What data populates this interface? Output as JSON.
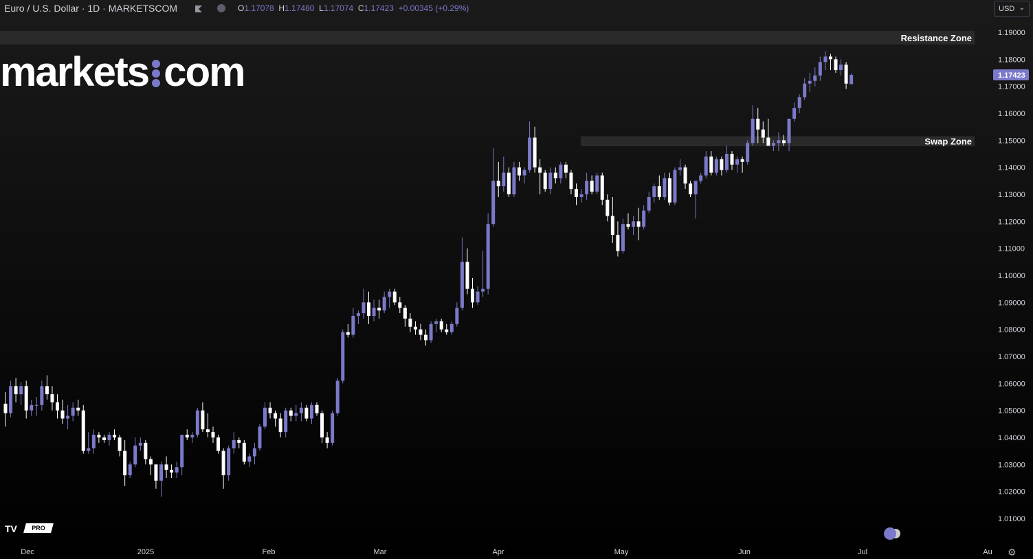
{
  "header": {
    "title": "Euro / U.S. Dollar · 1D · MARKETSCOM",
    "ohlc": {
      "o_label": "O",
      "o_value": "1.17078",
      "h_label": "H",
      "h_value": "1.17480",
      "l_label": "L",
      "l_value": "1.17074",
      "c_label": "C",
      "c_value": "1.17423",
      "change": "+0.00345 (+0.29%)"
    },
    "currency": "USD"
  },
  "logo": {
    "left": "markets",
    "right": "com"
  },
  "badge": {
    "brand": "TV",
    "pro": "PRO"
  },
  "colors": {
    "up": "#7b79c9",
    "down": "#ffffff",
    "zone": "#2a2a2a",
    "last_price_bg": "#7b79c9"
  },
  "chart_data": {
    "type": "candlestick",
    "symbol": "EURUSD",
    "interval": "1D",
    "last_price": "1.17423",
    "ylim": [
      1.005,
      1.1915
    ],
    "y_ticks": [
      "1.19000",
      "1.18000",
      "1.17000",
      "1.16000",
      "1.15000",
      "1.14000",
      "1.13000",
      "1.12000",
      "1.11000",
      "1.10000",
      "1.09000",
      "1.08000",
      "1.07000",
      "1.06000",
      "1.05000",
      "1.04000",
      "1.03000",
      "1.02000",
      "1.01000"
    ],
    "x_labels": [
      "Dec",
      "2025",
      "Feb",
      "Mar",
      "Apr",
      "May",
      "Jun",
      "Jul",
      "Au"
    ],
    "zones": [
      {
        "label": "Resistance Zone",
        "low": 1.1855,
        "high": 1.1905
      },
      {
        "label": "Swap Zone",
        "low": 1.1478,
        "high": 1.1515
      }
    ],
    "candles": [
      [
        1.0525,
        1.0568,
        1.044,
        1.049
      ],
      [
        1.049,
        1.061,
        1.0475,
        1.059
      ],
      [
        1.059,
        1.062,
        1.053,
        1.056
      ],
      [
        1.056,
        1.0605,
        1.052,
        1.059
      ],
      [
        1.059,
        1.061,
        1.047,
        1.05
      ],
      [
        1.05,
        1.054,
        1.048,
        1.052
      ],
      [
        1.052,
        1.055,
        1.048,
        1.052
      ],
      [
        1.052,
        1.061,
        1.05,
        1.059
      ],
      [
        1.059,
        1.063,
        1.054,
        1.056
      ],
      [
        1.056,
        1.059,
        1.05,
        1.053
      ],
      [
        1.053,
        1.056,
        1.047,
        1.05
      ],
      [
        1.05,
        1.054,
        1.045,
        1.047
      ],
      [
        1.047,
        1.052,
        1.043,
        1.048
      ],
      [
        1.048,
        1.053,
        1.046,
        1.051
      ],
      [
        1.051,
        1.054,
        1.048,
        1.05
      ],
      [
        1.05,
        1.052,
        1.034,
        1.035
      ],
      [
        1.035,
        1.042,
        1.034,
        1.036
      ],
      [
        1.036,
        1.043,
        1.034,
        1.041
      ],
      [
        1.041,
        1.042,
        1.038,
        1.04
      ],
      [
        1.04,
        1.041,
        1.038,
        1.039
      ],
      [
        1.039,
        1.042,
        1.037,
        1.041
      ],
      [
        1.041,
        1.043,
        1.039,
        1.04
      ],
      [
        1.04,
        1.041,
        1.033,
        1.035
      ],
      [
        1.035,
        1.039,
        1.022,
        1.026
      ],
      [
        1.026,
        1.031,
        1.025,
        1.03
      ],
      [
        1.03,
        1.04,
        1.029,
        1.037
      ],
      [
        1.037,
        1.04,
        1.035,
        1.038
      ],
      [
        1.038,
        1.039,
        1.03,
        1.032
      ],
      [
        1.032,
        1.033,
        1.026,
        1.03
      ],
      [
        1.03,
        1.03,
        1.021,
        1.024
      ],
      [
        1.024,
        1.031,
        1.018,
        1.03
      ],
      [
        1.03,
        1.033,
        1.025,
        1.028
      ],
      [
        1.028,
        1.03,
        1.025,
        1.027
      ],
      [
        1.027,
        1.031,
        1.025,
        1.029
      ],
      [
        1.029,
        1.04,
        1.026,
        1.041
      ],
      [
        1.041,
        1.043,
        1.039,
        1.04
      ],
      [
        1.04,
        1.042,
        1.038,
        1.041
      ],
      [
        1.041,
        1.051,
        1.04,
        1.05
      ],
      [
        1.05,
        1.053,
        1.042,
        1.043
      ],
      [
        1.043,
        1.049,
        1.04,
        1.042
      ],
      [
        1.042,
        1.044,
        1.038,
        1.04
      ],
      [
        1.04,
        1.041,
        1.034,
        1.035
      ],
      [
        1.035,
        1.036,
        1.021,
        1.026
      ],
      [
        1.026,
        1.037,
        1.024,
        1.036
      ],
      [
        1.036,
        1.042,
        1.034,
        1.039
      ],
      [
        1.039,
        1.04,
        1.036,
        1.038
      ],
      [
        1.038,
        1.039,
        1.03,
        1.031
      ],
      [
        1.031,
        1.034,
        1.029,
        1.033
      ],
      [
        1.033,
        1.038,
        1.03,
        1.036
      ],
      [
        1.036,
        1.045,
        1.035,
        1.044
      ],
      [
        1.044,
        1.053,
        1.043,
        1.051
      ],
      [
        1.051,
        1.053,
        1.047,
        1.049
      ],
      [
        1.049,
        1.05,
        1.044,
        1.047
      ],
      [
        1.047,
        1.049,
        1.04,
        1.042
      ],
      [
        1.042,
        1.051,
        1.04,
        1.05
      ],
      [
        1.05,
        1.051,
        1.046,
        1.048
      ],
      [
        1.048,
        1.052,
        1.046,
        1.049
      ],
      [
        1.049,
        1.053,
        1.046,
        1.051
      ],
      [
        1.051,
        1.052,
        1.046,
        1.047
      ],
      [
        1.047,
        1.053,
        1.045,
        1.052
      ],
      [
        1.052,
        1.053,
        1.048,
        1.049
      ],
      [
        1.049,
        1.05,
        1.038,
        1.04
      ],
      [
        1.04,
        1.042,
        1.036,
        1.038
      ],
      [
        1.038,
        1.05,
        1.037,
        1.049
      ],
      [
        1.049,
        1.062,
        1.048,
        1.061
      ],
      [
        1.061,
        1.08,
        1.06,
        1.079
      ],
      [
        1.079,
        1.082,
        1.077,
        1.078
      ],
      [
        1.078,
        1.088,
        1.077,
        1.085
      ],
      [
        1.085,
        1.087,
        1.082,
        1.086
      ],
      [
        1.086,
        1.095,
        1.084,
        1.09
      ],
      [
        1.09,
        1.094,
        1.082,
        1.085
      ],
      [
        1.085,
        1.091,
        1.083,
        1.088
      ],
      [
        1.088,
        1.091,
        1.084,
        1.087
      ],
      [
        1.087,
        1.094,
        1.086,
        1.092
      ],
      [
        1.092,
        1.095,
        1.088,
        1.094
      ],
      [
        1.094,
        1.095,
        1.089,
        1.09
      ],
      [
        1.09,
        1.092,
        1.086,
        1.088
      ],
      [
        1.088,
        1.089,
        1.081,
        1.084
      ],
      [
        1.084,
        1.086,
        1.079,
        1.081
      ],
      [
        1.081,
        1.083,
        1.078,
        1.08
      ],
      [
        1.08,
        1.082,
        1.076,
        1.078
      ],
      [
        1.078,
        1.08,
        1.074,
        1.076
      ],
      [
        1.076,
        1.083,
        1.075,
        1.082
      ],
      [
        1.082,
        1.084,
        1.079,
        1.083
      ],
      [
        1.083,
        1.084,
        1.079,
        1.08
      ],
      [
        1.08,
        1.082,
        1.078,
        1.079
      ],
      [
        1.079,
        1.083,
        1.078,
        1.082
      ],
      [
        1.082,
        1.09,
        1.081,
        1.088
      ],
      [
        1.088,
        1.114,
        1.087,
        1.105
      ],
      [
        1.105,
        1.11,
        1.093,
        1.095
      ],
      [
        1.095,
        1.099,
        1.088,
        1.09
      ],
      [
        1.09,
        1.096,
        1.089,
        1.094
      ],
      [
        1.094,
        1.109,
        1.092,
        1.095
      ],
      [
        1.095,
        1.123,
        1.093,
        1.119
      ],
      [
        1.119,
        1.147,
        1.118,
        1.135
      ],
      [
        1.135,
        1.142,
        1.129,
        1.133
      ],
      [
        1.133,
        1.144,
        1.131,
        1.138
      ],
      [
        1.138,
        1.14,
        1.129,
        1.13
      ],
      [
        1.13,
        1.142,
        1.129,
        1.14
      ],
      [
        1.14,
        1.142,
        1.135,
        1.137
      ],
      [
        1.137,
        1.14,
        1.134,
        1.139
      ],
      [
        1.139,
        1.157,
        1.138,
        1.151
      ],
      [
        1.151,
        1.155,
        1.138,
        1.14
      ],
      [
        1.14,
        1.143,
        1.13,
        1.138
      ],
      [
        1.138,
        1.139,
        1.131,
        1.132
      ],
      [
        1.132,
        1.14,
        1.13,
        1.138
      ],
      [
        1.138,
        1.14,
        1.134,
        1.136
      ],
      [
        1.136,
        1.142,
        1.134,
        1.141
      ],
      [
        1.141,
        1.142,
        1.136,
        1.138
      ],
      [
        1.138,
        1.139,
        1.13,
        1.132
      ],
      [
        1.132,
        1.134,
        1.126,
        1.129
      ],
      [
        1.129,
        1.132,
        1.127,
        1.13
      ],
      [
        1.13,
        1.138,
        1.128,
        1.135
      ],
      [
        1.135,
        1.137,
        1.13,
        1.131
      ],
      [
        1.131,
        1.138,
        1.13,
        1.137
      ],
      [
        1.137,
        1.138,
        1.126,
        1.128
      ],
      [
        1.128,
        1.13,
        1.12,
        1.122
      ],
      [
        1.122,
        1.129,
        1.112,
        1.115
      ],
      [
        1.115,
        1.12,
        1.107,
        1.109
      ],
      [
        1.109,
        1.121,
        1.108,
        1.119
      ],
      [
        1.119,
        1.123,
        1.117,
        1.118
      ],
      [
        1.118,
        1.122,
        1.115,
        1.12
      ],
      [
        1.12,
        1.125,
        1.113,
        1.118
      ],
      [
        1.118,
        1.126,
        1.117,
        1.124
      ],
      [
        1.124,
        1.131,
        1.123,
        1.129
      ],
      [
        1.129,
        1.134,
        1.127,
        1.133
      ],
      [
        1.133,
        1.137,
        1.128,
        1.129
      ],
      [
        1.129,
        1.138,
        1.128,
        1.136
      ],
      [
        1.136,
        1.138,
        1.126,
        1.127
      ],
      [
        1.127,
        1.14,
        1.126,
        1.139
      ],
      [
        1.139,
        1.143,
        1.137,
        1.14
      ],
      [
        1.14,
        1.141,
        1.132,
        1.134
      ],
      [
        1.134,
        1.135,
        1.129,
        1.13
      ],
      [
        1.13,
        1.132,
        1.121,
        1.135
      ],
      [
        1.135,
        1.138,
        1.134,
        1.137
      ],
      [
        1.137,
        1.146,
        1.136,
        1.144
      ],
      [
        1.144,
        1.146,
        1.137,
        1.138
      ],
      [
        1.138,
        1.144,
        1.137,
        1.143
      ],
      [
        1.143,
        1.144,
        1.137,
        1.139
      ],
      [
        1.139,
        1.148,
        1.138,
        1.145
      ],
      [
        1.145,
        1.146,
        1.139,
        1.141
      ],
      [
        1.141,
        1.144,
        1.138,
        1.143
      ],
      [
        1.143,
        1.144,
        1.138,
        1.142
      ],
      [
        1.142,
        1.15,
        1.141,
        1.149
      ],
      [
        1.149,
        1.163,
        1.148,
        1.158
      ],
      [
        1.158,
        1.162,
        1.149,
        1.154
      ],
      [
        1.154,
        1.157,
        1.149,
        1.151
      ],
      [
        1.151,
        1.158,
        1.148,
        1.148
      ],
      [
        1.148,
        1.15,
        1.146,
        1.149
      ],
      [
        1.149,
        1.153,
        1.146,
        1.15
      ],
      [
        1.15,
        1.152,
        1.148,
        1.149
      ],
      [
        1.149,
        1.15,
        1.146,
        1.158
      ],
      [
        1.158,
        1.164,
        1.157,
        1.162
      ],
      [
        1.162,
        1.167,
        1.16,
        1.166
      ],
      [
        1.166,
        1.173,
        1.165,
        1.171
      ],
      [
        1.171,
        1.175,
        1.168,
        1.172
      ],
      [
        1.172,
        1.177,
        1.17,
        1.174
      ],
      [
        1.174,
        1.181,
        1.172,
        1.179
      ],
      [
        1.179,
        1.183,
        1.176,
        1.181
      ],
      [
        1.181,
        1.182,
        1.176,
        1.18
      ],
      [
        1.18,
        1.181,
        1.175,
        1.176
      ],
      [
        1.176,
        1.18,
        1.174,
        1.178
      ],
      [
        1.178,
        1.179,
        1.169,
        1.171
      ],
      [
        1.17078,
        1.1748,
        1.17074,
        1.17423
      ]
    ]
  }
}
